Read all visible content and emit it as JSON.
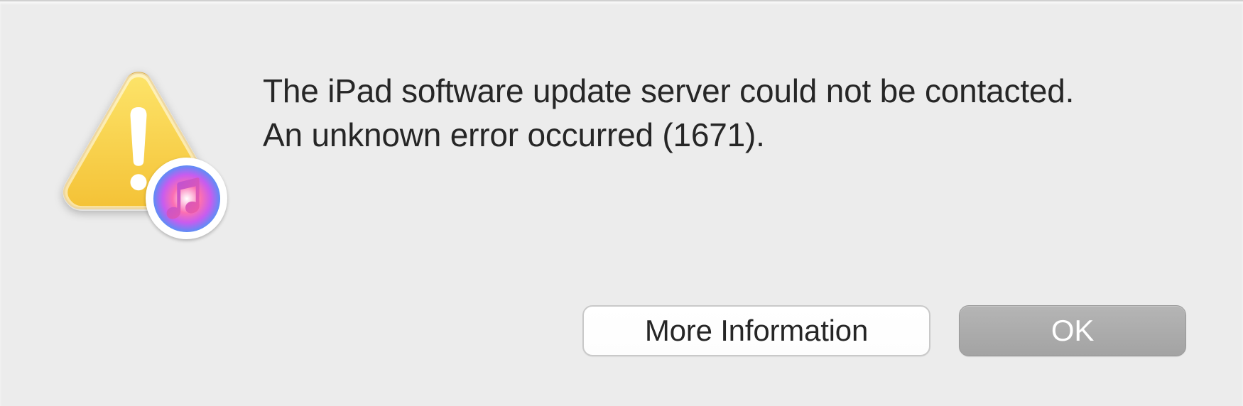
{
  "dialog": {
    "message_line1": "The iPad software update server could not be contacted.",
    "message_line2": "An unknown error occurred (1671).",
    "buttons": {
      "more_info": "More Information",
      "ok": "OK"
    }
  }
}
